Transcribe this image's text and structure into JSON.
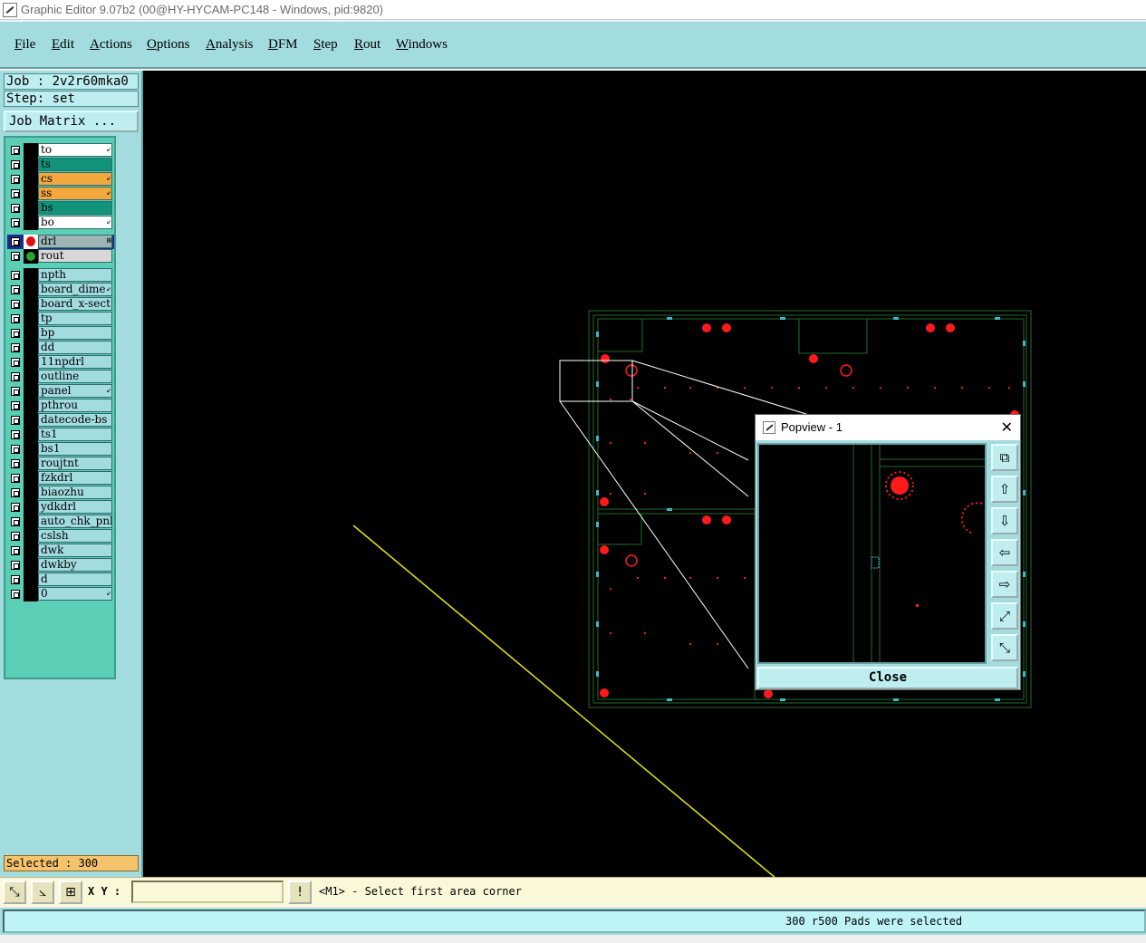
{
  "window": {
    "title": "Graphic Editor 9.07b2 (00@HY-HYCAM-PC148 - Windows, pid:9820)"
  },
  "menu": [
    "File",
    "Edit",
    "Actions",
    "Options",
    "Analysis",
    "DFM",
    "Step",
    "Rout",
    "Windows"
  ],
  "job": {
    "job_line": "Job : 2v2r60mka0",
    "step_line": "Step: set",
    "matrix_button": "Job Matrix ..."
  },
  "layers": {
    "board": [
      {
        "name": "to",
        "color": "#ffffff",
        "mark": "⇙"
      },
      {
        "name": "ts",
        "color": "#12947a",
        "mark": ""
      },
      {
        "name": "cs",
        "color": "#f3a83e",
        "mark": "⇙"
      },
      {
        "name": "ss",
        "color": "#f3a83e",
        "mark": "⇙"
      },
      {
        "name": "bs",
        "color": "#12947a",
        "mark": ""
      },
      {
        "name": "bo",
        "color": "#ffffff",
        "mark": "⇙"
      }
    ],
    "drill": [
      {
        "name": "drl",
        "color": "#9fb5b5",
        "mark": "⊞"
      },
      {
        "name": "rout",
        "color": "#d8d8d8",
        "mark": ""
      }
    ],
    "misc": [
      {
        "name": "npth",
        "color": "#a3dcdf",
        "mark": ""
      },
      {
        "name": "board_dime",
        "color": "#a3dcdf",
        "mark": "⇙"
      },
      {
        "name": "board_x-sect",
        "color": "#a3dcdf",
        "mark": ""
      },
      {
        "name": "tp",
        "color": "#a3dcdf",
        "mark": ""
      },
      {
        "name": "bp",
        "color": "#a3dcdf",
        "mark": ""
      },
      {
        "name": "dd",
        "color": "#a3dcdf",
        "mark": ""
      },
      {
        "name": "11npdrl",
        "color": "#a3dcdf",
        "mark": ""
      },
      {
        "name": "outline",
        "color": "#a3dcdf",
        "mark": ""
      },
      {
        "name": "panel",
        "color": "#a3dcdf",
        "mark": "⇙"
      },
      {
        "name": "pthrou",
        "color": "#a3dcdf",
        "mark": ""
      },
      {
        "name": "datecode-bs",
        "color": "#a3dcdf",
        "mark": ""
      },
      {
        "name": "ts1",
        "color": "#a3dcdf",
        "mark": ""
      },
      {
        "name": "bs1",
        "color": "#a3dcdf",
        "mark": ""
      },
      {
        "name": "roujtnt",
        "color": "#a3dcdf",
        "mark": ""
      },
      {
        "name": "fzkdrl",
        "color": "#a3dcdf",
        "mark": ""
      },
      {
        "name": "biaozhu",
        "color": "#a3dcdf",
        "mark": ""
      },
      {
        "name": "ydkdrl",
        "color": "#a3dcdf",
        "mark": ""
      },
      {
        "name": "auto_chk_pnl",
        "color": "#a3dcdf",
        "mark": ""
      },
      {
        "name": "cslsh",
        "color": "#a3dcdf",
        "mark": ""
      },
      {
        "name": "dwk",
        "color": "#a3dcdf",
        "mark": ""
      },
      {
        "name": "dwkby",
        "color": "#a3dcdf",
        "mark": ""
      },
      {
        "name": "d",
        "color": "#a3dcdf",
        "mark": ""
      },
      {
        "name": "0",
        "color": "#a3dcdf",
        "mark": "⇙"
      }
    ]
  },
  "selected": "Selected : 300",
  "popview": {
    "title": "Popview - 1",
    "close_label": "Close"
  },
  "prompt": {
    "xy_label": "X Y :",
    "xy_value": "",
    "message": "<M1> - Select first area corner"
  },
  "status": {
    "message": "300 r500 Pads were selected"
  },
  "colors": {
    "panel": "#a3dcdf",
    "layer_panel": "#5bcfb6",
    "canvas": "#000000",
    "pad": "#ff1a1a",
    "outline": "#1f6b2d",
    "drill_ref": "#3fb7c9",
    "guide_line": "#e6e600"
  }
}
